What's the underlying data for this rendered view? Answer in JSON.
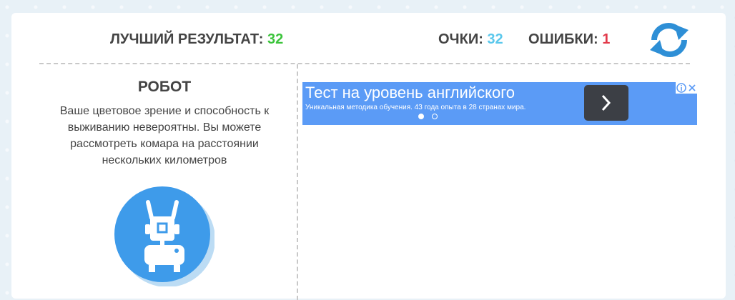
{
  "header": {
    "best_label": "ЛУЧШИЙ РЕЗУЛЬТАТ:",
    "best_value": "32",
    "score_label": "ОЧКИ:",
    "score_value": "32",
    "errors_label": "ОШИБКИ:",
    "errors_value": "1"
  },
  "rank": {
    "title": "РОБОТ",
    "description": "Ваше цветовое зрение и способность к выживанию невероятны. Вы можете рассмотреть комара на расстоянии нескольких километров",
    "icon": "robot-icon"
  },
  "ad": {
    "title": "Тест на уровень английского",
    "subtitle": "Уникальная методика обучения. 43 года опыта в 28 странах мира.",
    "pager_total": 2,
    "pager_active": 1
  },
  "colors": {
    "best": "#3cc43c",
    "score": "#5bc8ec",
    "errors": "#e23a4a",
    "refresh": "#2e8fd6",
    "avatar_bg": "#3e9bea",
    "ad_bg": "#5b9bf6"
  }
}
